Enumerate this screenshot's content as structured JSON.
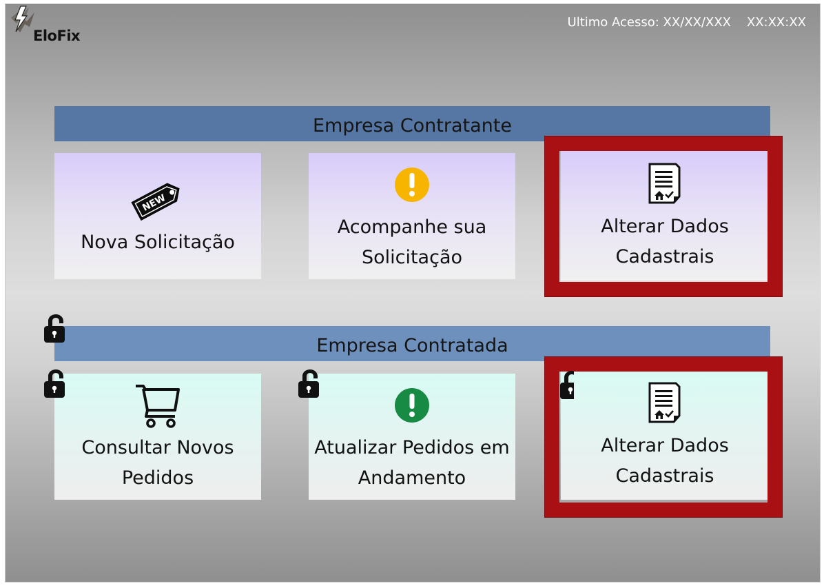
{
  "app": {
    "name": "EloFix",
    "last_access": "Ultimo Acesso: XX/XX/XXX    XX:XX:XX"
  },
  "sections": [
    {
      "title": "Empresa Contratante",
      "cards": [
        {
          "label": "Nova Solicitação",
          "icon": "new-tag-icon"
        },
        {
          "label": "Acompanhe sua Solicitação",
          "icon": "alert-icon-yellow"
        },
        {
          "label": "Alterar Dados Cadastrais",
          "icon": "document-icon"
        }
      ]
    },
    {
      "title": "Empresa Contratada",
      "cards": [
        {
          "label": "Consultar Novos Pedidos",
          "icon": "cart-icon"
        },
        {
          "label": "Atualizar Pedidos em Andamento",
          "icon": "alert-icon-green"
        },
        {
          "label": "Alterar Dados Cadastrais",
          "icon": "document-icon"
        }
      ]
    }
  ],
  "icons": {
    "new_tag_text": "NEW",
    "lock_icon": "padlock-unlocked-icon"
  },
  "colors": {
    "header_bar_top": "#5677a3",
    "header_bar_bottom": "#6e90bd",
    "highlight_border": "#a81014",
    "alert_yellow": "#f7b500",
    "alert_green": "#178a44"
  }
}
